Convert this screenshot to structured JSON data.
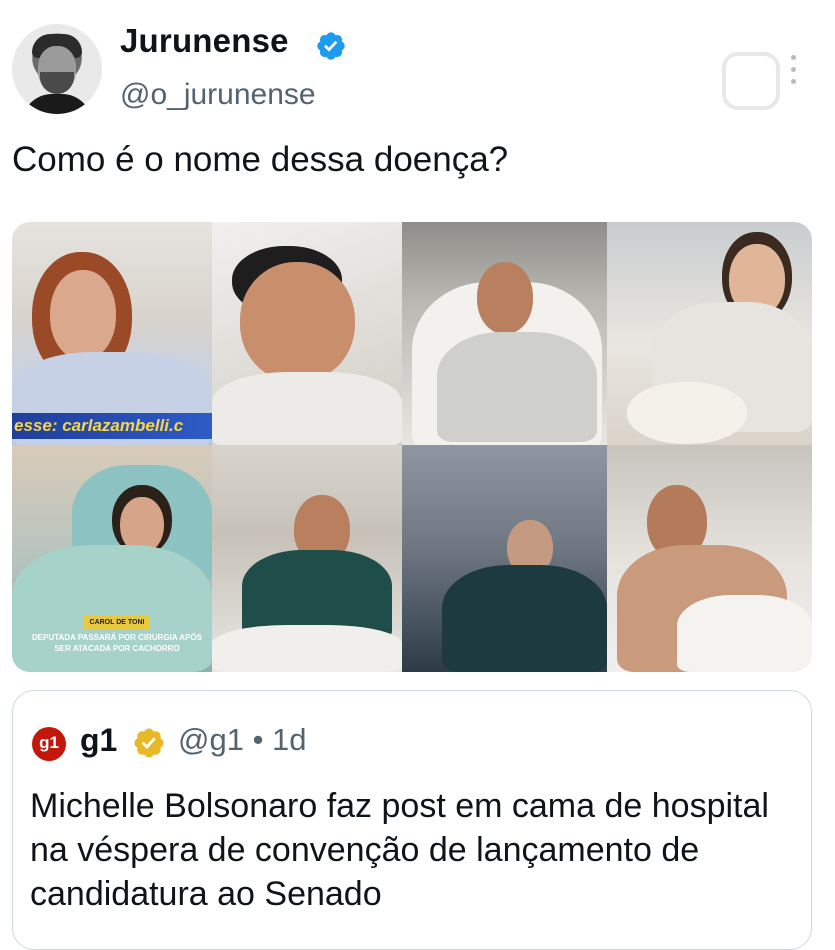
{
  "post": {
    "author_name": "Jurunense",
    "author_handle": "@o_jurunense",
    "text": "Como é o nome dessa doença?"
  },
  "images": {
    "photo_1_caption": "esse: carlazambelli.c",
    "photo_5_tag": "CAROL DE TONI",
    "photo_5_caption": "DEPUTADA PASSARÁ POR CIRURGIA APÓS SER ATACADA POR CACHORRO"
  },
  "quoted": {
    "logo_text": "g1",
    "name": "g1",
    "meta": "@g1 • 1d",
    "text": "Michelle Bolsonaro faz post em cama de hospital na véspera de convenção de lançamento de candidatura ao Senado"
  },
  "colors": {
    "verified_blue": "#1d9bf0",
    "verified_gold": "#e8b827",
    "g1_red": "#c4170c",
    "secondary_text": "#536471"
  },
  "icons": {
    "verified": "verified-badge-icon",
    "gold_verified": "gold-verified-badge-icon",
    "more": "more-options-icon"
  }
}
